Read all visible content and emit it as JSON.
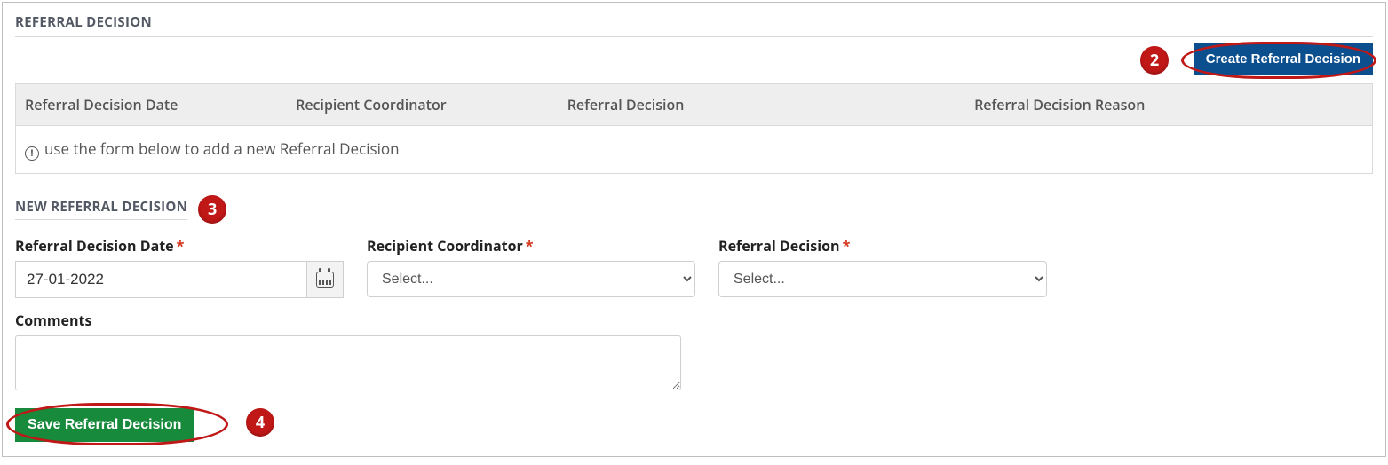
{
  "section": {
    "title": "REFERRAL DECISION"
  },
  "toolbar": {
    "create_label": "Create Referral Decision"
  },
  "table": {
    "cols": {
      "date": "Referral Decision Date",
      "coord": "Recipient Coordinator",
      "decision": "Referral Decision",
      "reason": "Referral Decision Reason"
    },
    "empty_msg": "use the form below to add a new Referral Decision"
  },
  "form": {
    "title": "NEW REFERRAL DECISION",
    "date": {
      "label": "Referral Decision Date",
      "value": "27-01-2022"
    },
    "coord": {
      "label": "Recipient Coordinator",
      "placeholder": "Select..."
    },
    "decision": {
      "label": "Referral Decision",
      "placeholder": "Select..."
    },
    "comments": {
      "label": "Comments",
      "value": ""
    },
    "required_mark": "*",
    "save_label": "Save Referral Decision"
  },
  "annotations": {
    "b2": "2",
    "b3": "3",
    "b4": "4"
  }
}
